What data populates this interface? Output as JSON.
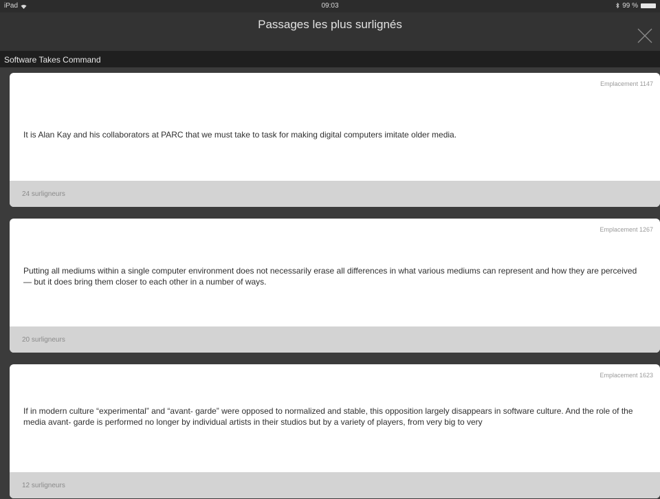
{
  "status_bar": {
    "device": "iPad",
    "time": "09:03",
    "battery": "99 %"
  },
  "nav": {
    "title": "Passages les plus surlignés"
  },
  "book": {
    "title": "Software Takes Command"
  },
  "passages": [
    {
      "location": "Emplacement 1147",
      "text": "It is Alan Kay and his collaborators at PARC that we must take to task for making digital computers imitate older media.",
      "highlighters": "24 surligneurs"
    },
    {
      "location": "Emplacement 1267",
      "text": "Putting all mediums within a single computer environment does not necessarily erase all differences in what various mediums can represent and how they are perceived— but it does bring them closer to each other in a number of ways.",
      "highlighters": "20 surligneurs"
    },
    {
      "location": "Emplacement 1623",
      "text": "If in modern culture “experimental” and “avant- garde” were opposed to normalized and stable, this opposition largely disappears in software culture. And the role of the media avant- garde is performed no longer by individual artists in their studios but by a variety of players, from very big to very",
      "highlighters": "12 surligneurs"
    }
  ]
}
